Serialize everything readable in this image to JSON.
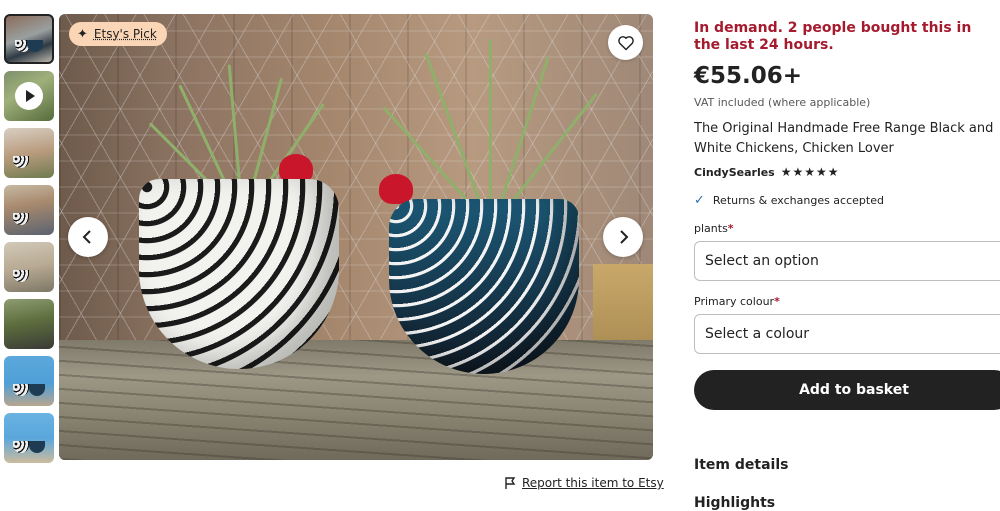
{
  "gallery": {
    "thumbnails": [
      {
        "name": "thumbnail-1",
        "active": true
      },
      {
        "name": "thumbnail-video",
        "video": true
      },
      {
        "name": "thumbnail-3"
      },
      {
        "name": "thumbnail-4"
      },
      {
        "name": "thumbnail-5"
      },
      {
        "name": "thumbnail-6"
      },
      {
        "name": "thumbnail-7"
      },
      {
        "name": "thumbnail-8"
      }
    ],
    "badge_label": "Etsy's Pick",
    "badge_icon": "sparkle-icon",
    "favorite_icon": "heart-icon",
    "prev_icon": "chevron-left-icon",
    "next_icon": "chevron-right-icon",
    "report_label": "Report this item to Etsy",
    "report_icon": "flag-icon"
  },
  "product": {
    "demand_text": "In demand. 2 people bought this in the last 24 hours.",
    "price": "€55.06+",
    "vat": "VAT included (where applicable)",
    "title": "The Original Handmade Free Range Black and White Chickens, Chicken Lover",
    "seller": "CindySearles",
    "rating": 5,
    "returns": "Returns & exchanges accepted"
  },
  "options": {
    "plants_label": "plants",
    "plants_placeholder": "Select an option",
    "colour_label": "Primary colour",
    "colour_placeholder": "Select a colour",
    "required_mark": "*"
  },
  "actions": {
    "add_to_basket": "Add to basket"
  },
  "sections": {
    "item_details": "Item details",
    "highlights": "Highlights"
  },
  "colors": {
    "demand": "#a61a2e",
    "badge_bg": "#fbd6b6",
    "primary_button": "#222222",
    "check": "#2f6fb5"
  }
}
